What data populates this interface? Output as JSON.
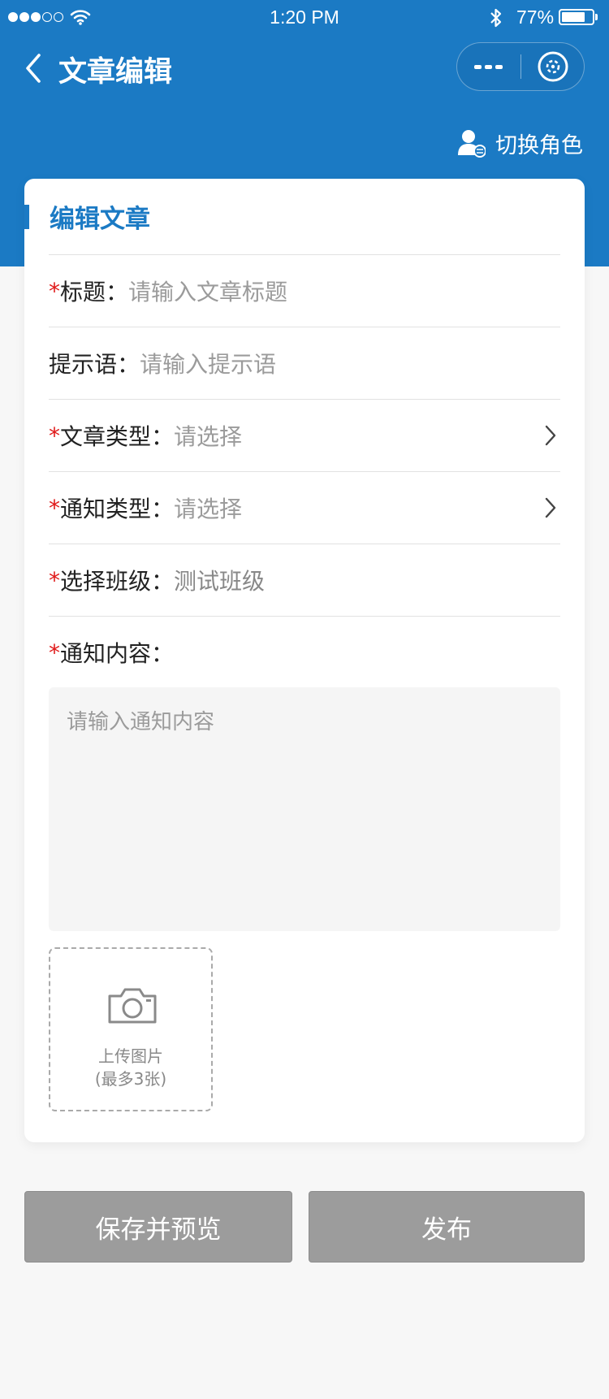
{
  "status_bar": {
    "time": "1:20 PM",
    "battery_percent": "77%",
    "battery_level": 0.77,
    "signal_dots_filled": 3,
    "signal_dots_total": 5
  },
  "nav": {
    "title": "文章编辑",
    "switch_role_label": "切换角色"
  },
  "card": {
    "title": "编辑文章"
  },
  "form": {
    "title_label": "标题：",
    "title_placeholder": "请输入文章标题",
    "hint_label": "提示语：",
    "hint_placeholder": "请输入提示语",
    "article_type_label": "文章类型：",
    "article_type_placeholder": "请选择",
    "notice_type_label": "通知类型：",
    "notice_type_placeholder": "请选择",
    "class_label": "选择班级：",
    "class_value": "测试班级",
    "content_label": "通知内容：",
    "content_placeholder": "请输入通知内容",
    "required_mark": "*"
  },
  "upload": {
    "line1": "上传图片",
    "line2": "(最多3张)"
  },
  "buttons": {
    "save_preview": "保存并预览",
    "publish": "发布"
  },
  "colors": {
    "brand": "#1b7ac4",
    "required": "#e01a1a",
    "button_gray": "#9c9c9c"
  },
  "icons": [
    "wifi-icon",
    "bluetooth-icon",
    "battery-icon",
    "back-arrow-icon",
    "more-icon",
    "close-circle-icon",
    "user-switch-icon",
    "chevron-right-icon",
    "camera-icon"
  ]
}
